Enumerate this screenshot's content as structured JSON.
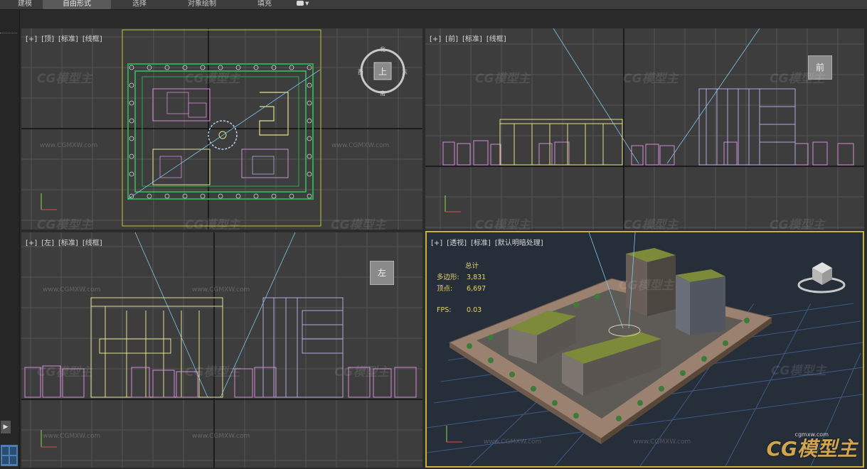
{
  "ribbon": {
    "tabs": [
      "建模",
      "自由形式",
      "选择",
      "对象绘制",
      "填充"
    ],
    "active_tab": "自由形式"
  },
  "viewports": {
    "top": {
      "label": [
        "[+]",
        "[顶]",
        "[标准]",
        "[线框]"
      ],
      "nav_center": "上",
      "compass": [
        "北",
        "南",
        "东",
        "西"
      ]
    },
    "front": {
      "label": [
        "[+]",
        "[前]",
        "[标准]",
        "[线框]"
      ],
      "cube": "前"
    },
    "left": {
      "label": [
        "[+]",
        "[左]",
        "[标准]",
        "[线框]"
      ],
      "cube": "左"
    },
    "perspective": {
      "label": [
        "[+]",
        "[透视]",
        "[标准]",
        "[默认明暗处理]"
      ],
      "stats": {
        "header": "总计",
        "polys_label": "多边形:",
        "polys_value": "3,831",
        "verts_label": "顶点:",
        "verts_value": "6,697",
        "fps_label": "FPS:",
        "fps_value": "0.03"
      },
      "cube": ""
    }
  },
  "watermark": {
    "brand": "CG模型主",
    "url": "www.CGMXW.com",
    "corner_url": "cgmxw.com"
  },
  "colors": {
    "viewport_bg": "#3d3d3d",
    "active_border": "#c9b23a",
    "persp_bg": "#262e3a",
    "stats_text": "#e6d36d"
  }
}
